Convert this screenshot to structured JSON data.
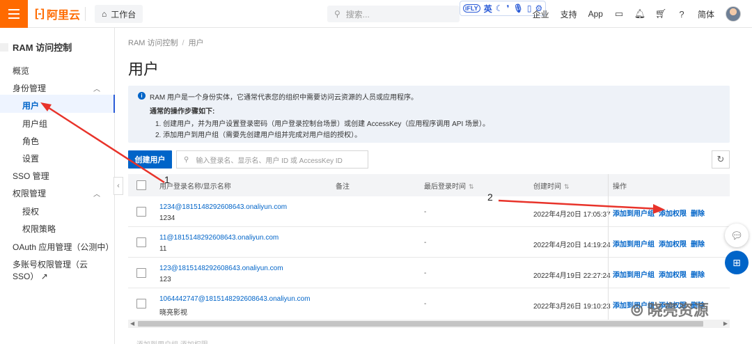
{
  "topbar": {
    "logo_text": "阿里云",
    "logo_mark": "[-]",
    "workbench": "工作台",
    "search_placeholder": "搜索...",
    "ifly": {
      "badge": "iFLY",
      "lang": "英"
    },
    "nav": [
      "企业",
      "支持",
      "App"
    ],
    "lang": "简体"
  },
  "sidebar": {
    "title": "RAM 访问控制",
    "overview": "概览",
    "identity": "身份管理",
    "users": "用户",
    "groups": "用户组",
    "roles": "角色",
    "settings": "设置",
    "sso": "SSO 管理",
    "perm": "权限管理",
    "grant": "授权",
    "policy": "权限策略",
    "oauth": "OAuth 应用管理（公测中）",
    "multi": "多账号权限管理（云 SSO）"
  },
  "main": {
    "breadcrumb": [
      "RAM 访问控制",
      "用户"
    ],
    "title": "用户",
    "notice": {
      "line1": "RAM 用户是一个身份实体，它通常代表您的组织中需要访问云资源的人员或应用程序。",
      "line2": "通常的操作步骤如下:",
      "line3": "1. 创建用户，并为用户设置登录密码（用户登录控制台场景）或创建 AccessKey（应用程序调用 API 场景）。",
      "line4": "2. 添加用户到用户组（需要先创建用户组并完成对用户组的授权）。"
    },
    "create_button": "创建用户",
    "search_placeholder": "输入登录名、显示名、用户 ID 或 AccessKey ID",
    "columns": {
      "name": "用户登录名称/显示名称",
      "note": "备注",
      "last_login": "最后登录时间",
      "created": "创建时间",
      "ops": "操作"
    },
    "rows": [
      {
        "name": "1234@1815148292608643.onaliyun.com",
        "display": "1234",
        "last_login": "-",
        "created": "2022年4月20日 17:05:37"
      },
      {
        "name": "11@1815148292608643.onaliyun.com",
        "display": "11",
        "last_login": "-",
        "created": "2022年4月20日 14:19:24"
      },
      {
        "name": "123@1815148292608643.onaliyun.com",
        "display": "123",
        "last_login": "-",
        "created": "2022年4月19日 22:27:24"
      },
      {
        "name": "1064442747@1815148292608643.onaliyun.com",
        "display": "晓亮影视",
        "last_login": "-",
        "created": "2022年3月26日 19:10:23"
      }
    ],
    "ops": {
      "add_group": "添加到用户组",
      "add_perm": "添加权限",
      "delete": "删除"
    },
    "bottom_text": "添加到用户组  添加权限"
  },
  "annotations": {
    "one": "1",
    "two": "2",
    "watermark": "晓亮资源"
  },
  "colors": {
    "brand": "#ff6a00",
    "primary": "#0064c8",
    "annotation_arrow": "#e8332a"
  }
}
